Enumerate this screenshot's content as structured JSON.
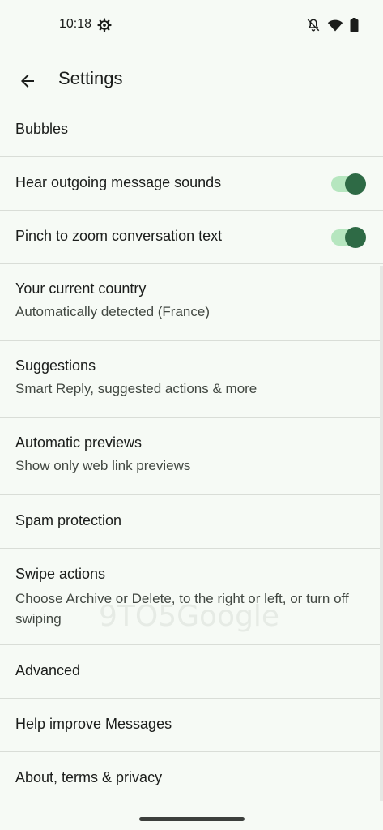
{
  "status_bar": {
    "time": "10:18",
    "icons": [
      "settings-gear-icon",
      "bell-off-icon",
      "wifi-icon",
      "battery-icon"
    ]
  },
  "app_bar": {
    "title": "Settings",
    "back_icon": "arrow-back-icon"
  },
  "settings": [
    {
      "id": "bubbles",
      "title": "Bubbles"
    },
    {
      "id": "outgoing-sounds",
      "title": "Hear outgoing message sounds",
      "toggle": true
    },
    {
      "id": "pinch-zoom",
      "title": "Pinch to zoom conversation text",
      "toggle": true
    },
    {
      "id": "country",
      "title": "Your current country",
      "subtitle": "Automatically detected (France)"
    },
    {
      "id": "suggestions",
      "title": "Suggestions",
      "subtitle": "Smart Reply, suggested actions & more"
    },
    {
      "id": "previews",
      "title": "Automatic previews",
      "subtitle": "Show only web link previews"
    },
    {
      "id": "spam",
      "title": "Spam protection"
    },
    {
      "id": "swipe",
      "title": "Swipe actions",
      "subtitle": "Choose Archive or Delete, to the right or left, or turn off swiping"
    },
    {
      "id": "advanced",
      "title": "Advanced"
    },
    {
      "id": "help",
      "title": "Help improve Messages"
    },
    {
      "id": "about",
      "title": "About, terms & privacy"
    }
  ],
  "watermark": "9TO5Google",
  "colors": {
    "background": "#f6faf5",
    "toggle_thumb": "#2e6a45",
    "toggle_track": "#b6e6bf",
    "divider": "#d9ddd7"
  }
}
